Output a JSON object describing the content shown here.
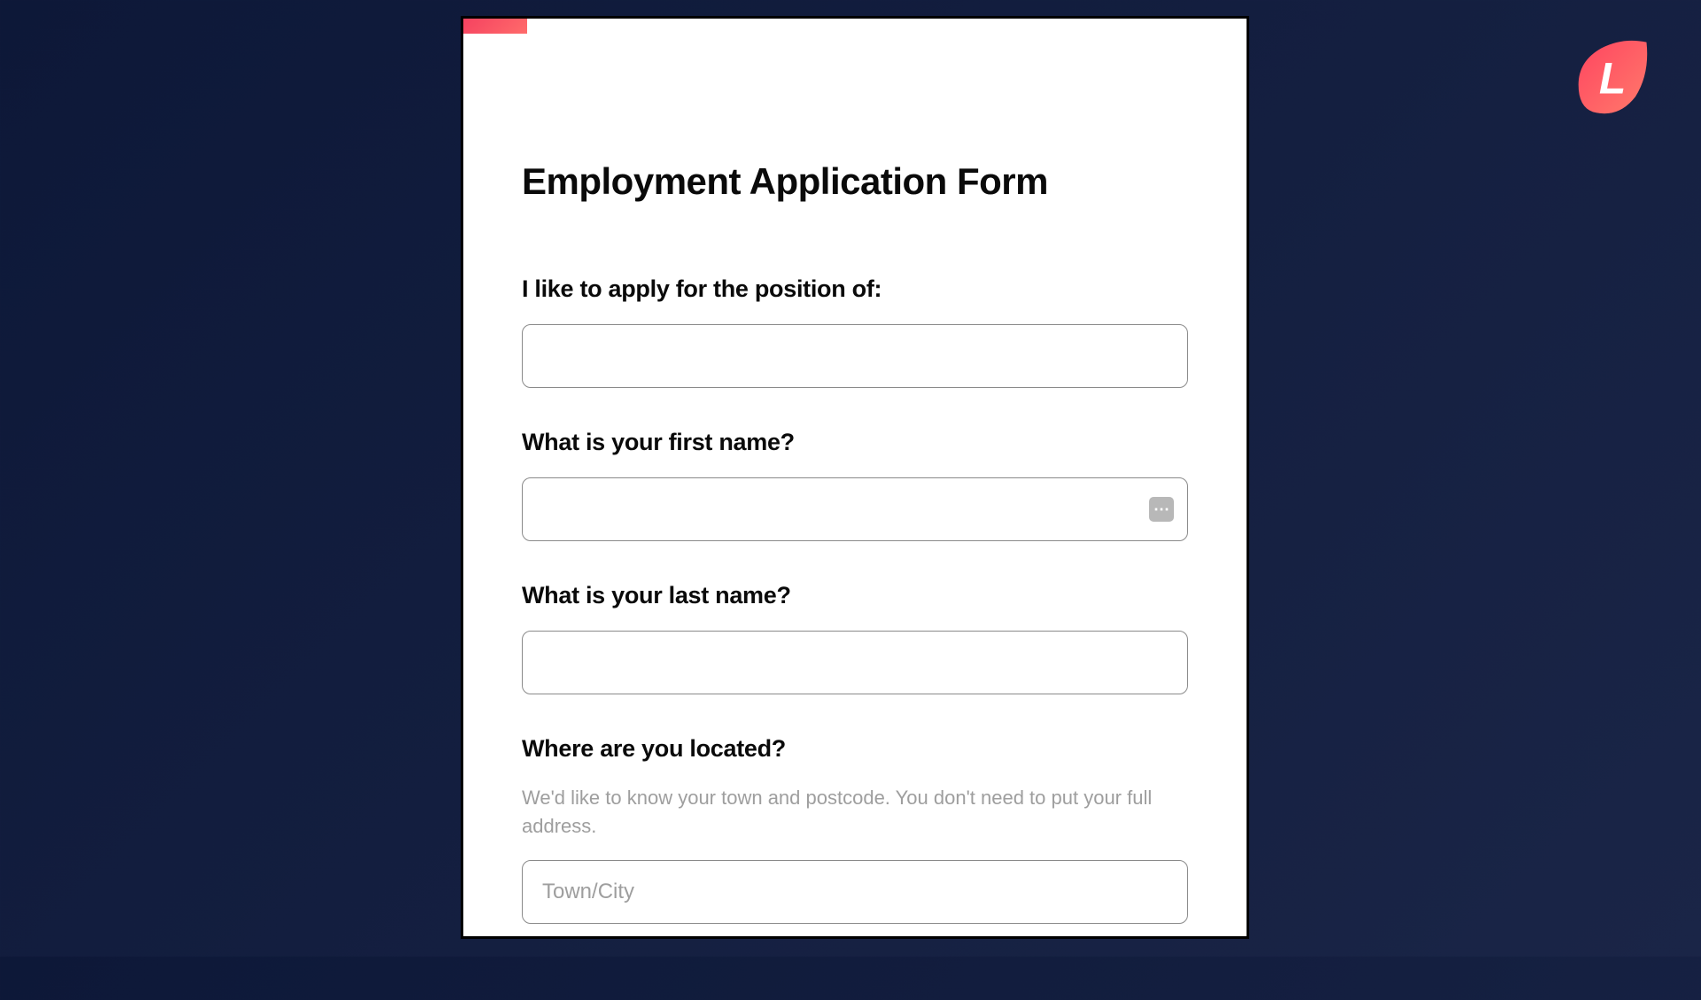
{
  "brand": {
    "letter": "L"
  },
  "form": {
    "title": "Employment Application Form",
    "fields": {
      "position": {
        "label": "I like to apply for the position of:",
        "value": "",
        "placeholder": ""
      },
      "first_name": {
        "label": "What is your first name?",
        "value": "",
        "placeholder": ""
      },
      "last_name": {
        "label": "What is your last name?",
        "value": "",
        "placeholder": ""
      },
      "location": {
        "label": "Where are you located?",
        "help": "We'd like to know your town and postcode. You don't need to put your full address.",
        "value": "",
        "placeholder": "Town/City"
      }
    }
  }
}
